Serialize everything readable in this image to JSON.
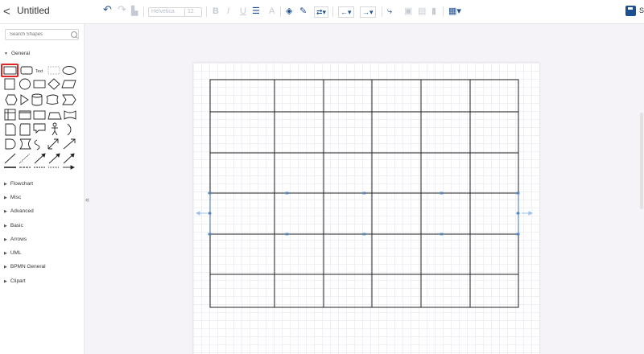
{
  "header": {
    "back_label": "<",
    "title": "Untitled",
    "save_label": "S"
  },
  "toolbar": {
    "font_family": "Helvetica",
    "font_size": "12",
    "icons": [
      "undo-icon",
      "redo-icon",
      "format-painter-icon",
      "bold-icon",
      "italic-icon",
      "underline-icon",
      "align-icon",
      "font-color-icon",
      "fill-color-icon",
      "line-color-icon",
      "connector-style-icon",
      "arrow-start-icon",
      "arrow-end-icon",
      "waypoint-icon",
      "to-front-icon",
      "to-back-icon",
      "lock-icon",
      "table-icon"
    ]
  },
  "sidebar": {
    "search_placeholder": "Search Shapes",
    "general_label": "General",
    "shape_text_label": "Text",
    "sections": [
      "Flowchart",
      "Misc",
      "Advanced",
      "Basic",
      "Arrows",
      "UML",
      "BPMN General",
      "Clipart"
    ]
  },
  "colors": {
    "accent": "#1d4f91",
    "highlight": "#e02424",
    "selection": "#4f86c6"
  }
}
